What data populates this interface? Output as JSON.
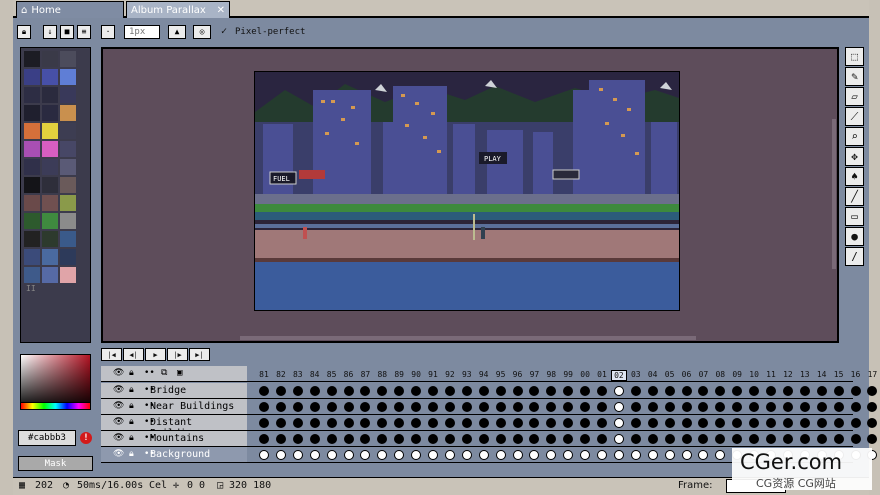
{
  "tabs": [
    {
      "label": "Home",
      "icon": "home-icon"
    },
    {
      "label": "Album Parallax",
      "icon": "close-icon"
    }
  ],
  "toolbar": {
    "brush_size": "1px",
    "pixel_perfect_label": "Pixel-perfect",
    "pixel_perfect_checked": true
  },
  "palette": {
    "page_marker": "II"
  },
  "color": {
    "hex": "#cabbb3",
    "warning": "!",
    "mask_label": "Mask"
  },
  "canvas": {
    "signs": {
      "fuel": "FUEL",
      "play": "PLAY"
    }
  },
  "timeline": {
    "header_icons": [
      "eye-icon",
      "lock-icon",
      "continuous-icon",
      "link-icon",
      "frame-icon"
    ],
    "frames": [
      "81",
      "82",
      "83",
      "84",
      "85",
      "86",
      "87",
      "88",
      "89",
      "90",
      "91",
      "92",
      "93",
      "94",
      "95",
      "96",
      "97",
      "98",
      "99",
      "00",
      "01",
      "02",
      "03",
      "04",
      "05",
      "06",
      "07",
      "08",
      "09",
      "10",
      "11",
      "12",
      "13",
      "14",
      "15",
      "16",
      "17"
    ],
    "current_frame": "02",
    "layers": [
      {
        "name": "Bridge",
        "selected": false,
        "visible": true
      },
      {
        "name": "Near Buildings",
        "selected": false,
        "visible": true
      },
      {
        "name": "Distant Buildings",
        "selected": false,
        "visible": true
      },
      {
        "name": "Mountains",
        "selected": false,
        "visible": true
      },
      {
        "name": "Background",
        "selected": true,
        "visible": true
      }
    ]
  },
  "status": {
    "frame_count": "202",
    "duration": "50ms/16.00s",
    "cel": "Cel",
    "position": "0 0",
    "size": "320 180",
    "frame_label": "Frame:"
  },
  "watermark": {
    "brand": "CGer.com",
    "sub": "CG资源 CG网站"
  },
  "colors": {
    "bg": "#7d8aa0",
    "canvas_bg": "#5e4d5b",
    "tab_active": "#a9b4c6",
    "selected_layer": "#8e99ae"
  }
}
